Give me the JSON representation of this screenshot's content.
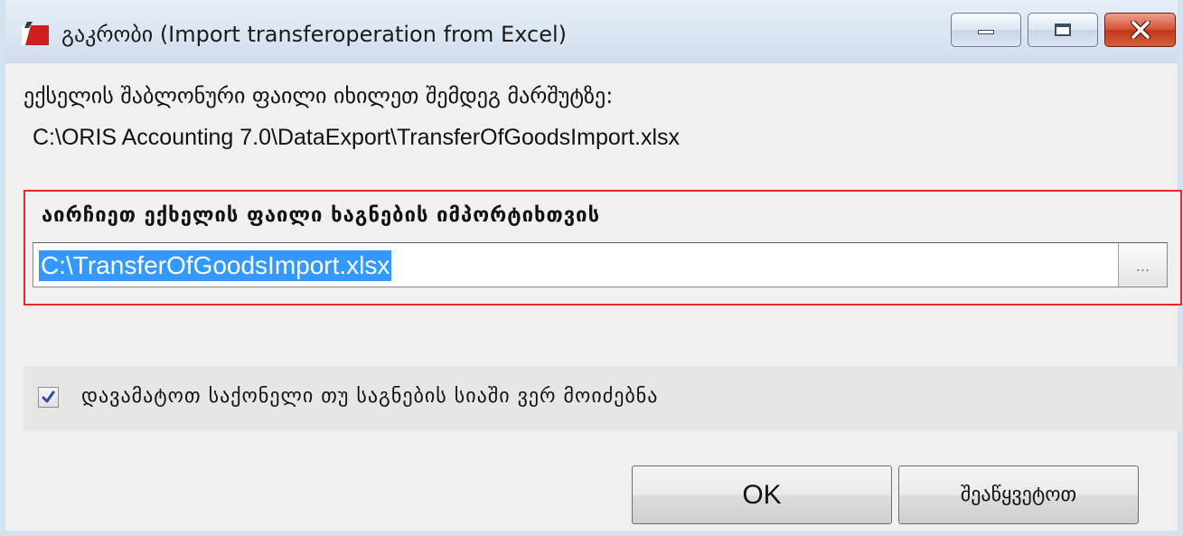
{
  "window": {
    "title": "გაკრობი (Import transferoperation from Excel)"
  },
  "info": {
    "line1": "ექსელის შაბლონური ფაილი იხილეთ შემდეგ მარშუტზე:",
    "line2": "C:\\ORIS Accounting 7.0\\DataExport\\TransferOfGoodsImport.xlsx"
  },
  "file_group": {
    "label": "აირჩიეთ ექხელის ფაილი ხაგნების იმპორტიხთვის",
    "input_value": "C:\\TransferOfGoodsImport.xlsx",
    "browse_label": "..."
  },
  "checkbox": {
    "label": "დავამატოთ საქონელი თუ საგნების სიაში ვერ მოიძებნა",
    "checked": true
  },
  "buttons": {
    "ok_label": "OK",
    "cancel_label": "შეაწყვეტოთ"
  },
  "colors": {
    "group_border": "#e8282a",
    "selection": "#3399ff",
    "close_button": "#c8431f"
  }
}
